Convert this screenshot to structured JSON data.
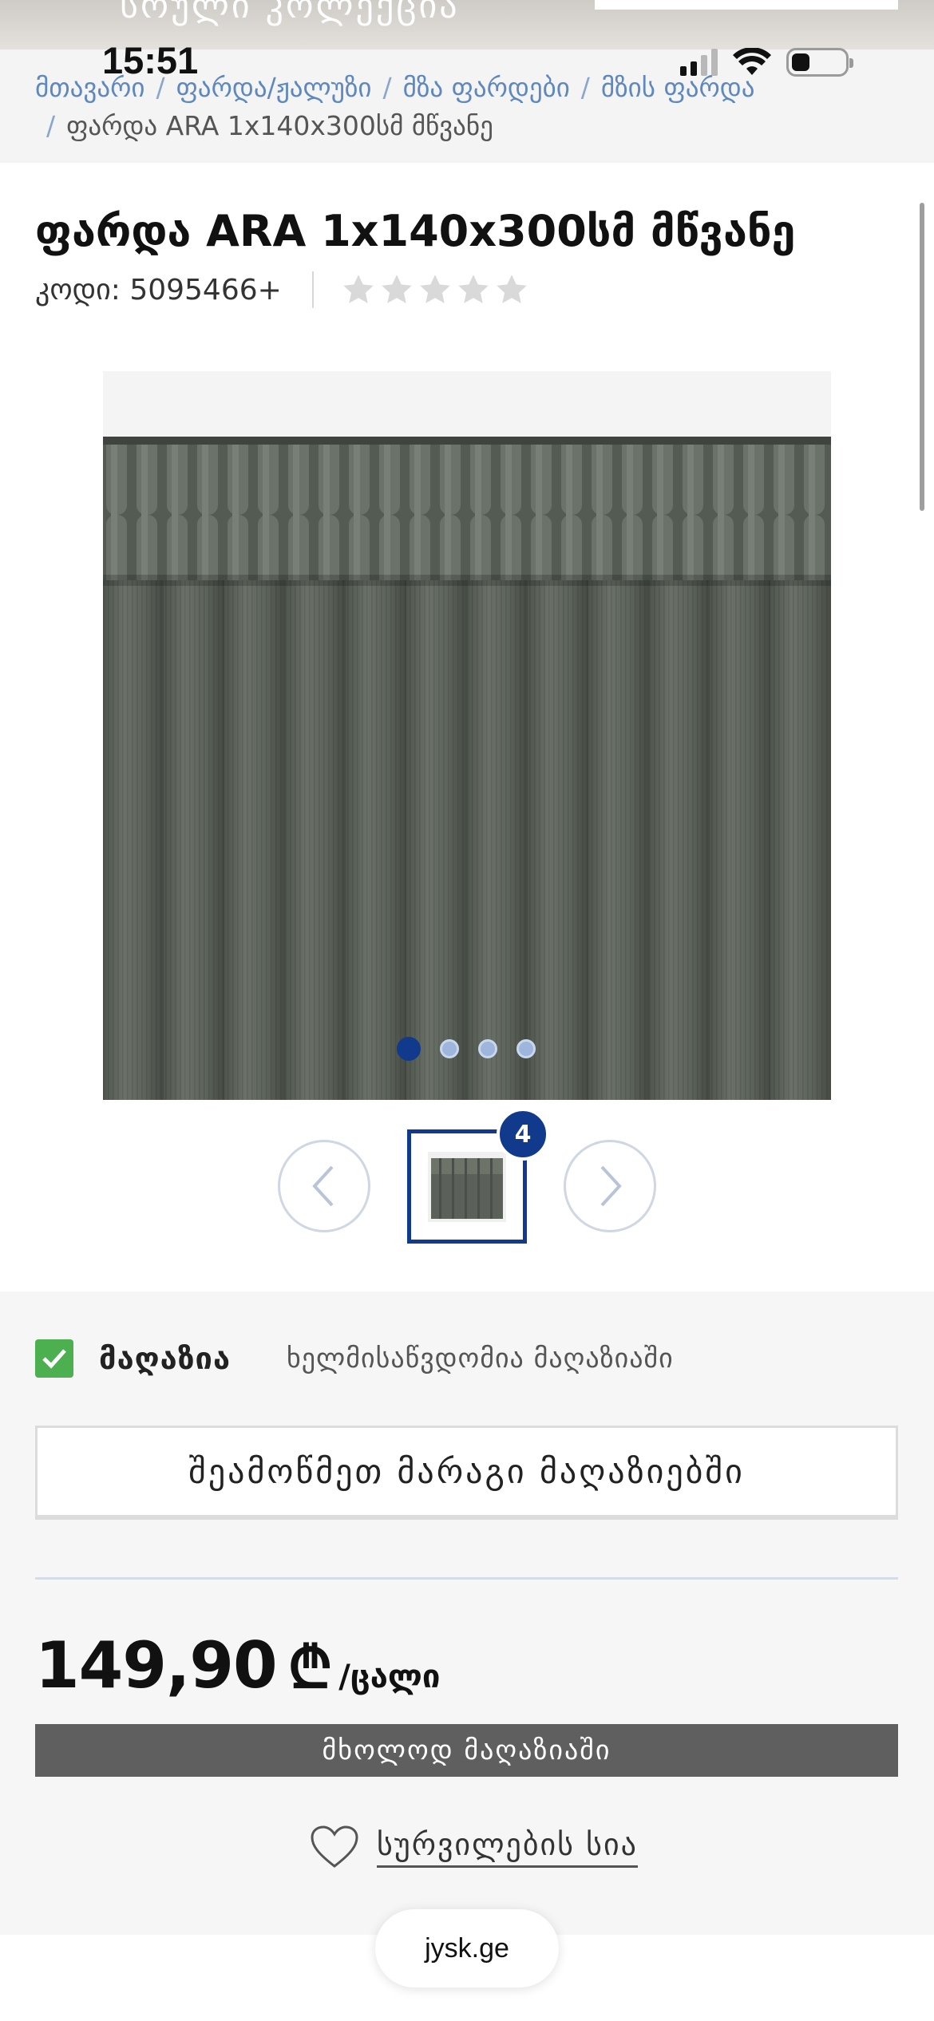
{
  "banner": {
    "text": "სრული კოლექცია"
  },
  "status_bar": {
    "time": "15:51"
  },
  "breadcrumb": {
    "items": [
      "მთავარი",
      "ფარდა/ჟალუზი",
      "მზა ფარდები",
      "მზის ფარდა"
    ],
    "current": "ფარდა ARA 1x140x300სმ მწვანე"
  },
  "product": {
    "title": "ფარდა ARA 1x140x300სმ მწვანე",
    "code_label": "კოდი: 5095466+",
    "rating": {
      "value": 0,
      "max": 5
    },
    "gallery": {
      "image_count": 4,
      "active_index": 0,
      "thumb_badge": "4"
    }
  },
  "availability": {
    "store_label": "მაღაზია",
    "store_status": "ხელმისაწვდომია მაღაზიაში",
    "check_stock_label": "შეამოწმეთ მარაგი მაღაზიებში"
  },
  "price": {
    "value": "149,90",
    "currency": "₾",
    "unit": "/ცალი",
    "store_only_label": "მხოლოდ მაღაზიაში"
  },
  "wishlist": {
    "label": "სურვილების სია"
  },
  "browser": {
    "url": "jysk.ge"
  },
  "colors": {
    "link": "#5f88bf",
    "accent_navy": "#123a8c",
    "in_stock_green": "#4caf50",
    "button_grey": "#5f5f5f",
    "curtain_green": "#5b6159"
  },
  "icons": [
    "signal-icon",
    "wifi-icon",
    "battery-icon",
    "star-icon",
    "chevron-left-icon",
    "chevron-right-icon",
    "check-icon",
    "heart-icon"
  ]
}
